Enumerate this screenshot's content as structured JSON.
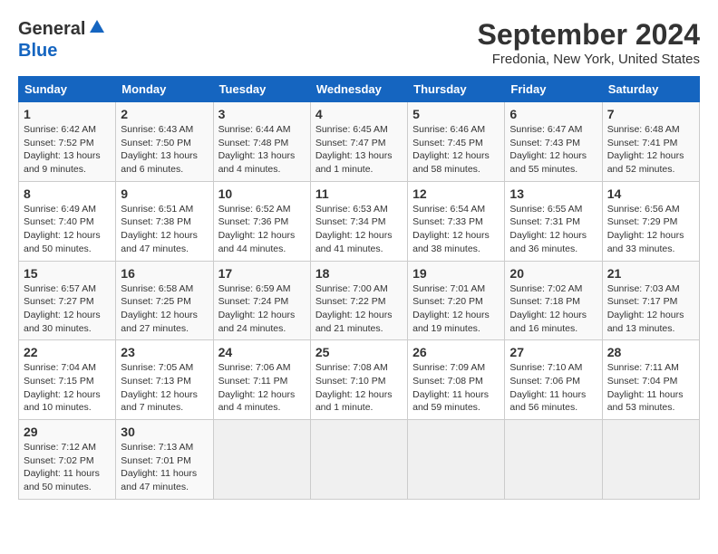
{
  "header": {
    "logo_general": "General",
    "logo_blue": "Blue",
    "month_title": "September 2024",
    "location": "Fredonia, New York, United States"
  },
  "days_of_week": [
    "Sunday",
    "Monday",
    "Tuesday",
    "Wednesday",
    "Thursday",
    "Friday",
    "Saturday"
  ],
  "weeks": [
    [
      {
        "day": "1",
        "info": "Sunrise: 6:42 AM\nSunset: 7:52 PM\nDaylight: 13 hours\nand 9 minutes."
      },
      {
        "day": "2",
        "info": "Sunrise: 6:43 AM\nSunset: 7:50 PM\nDaylight: 13 hours\nand 6 minutes."
      },
      {
        "day": "3",
        "info": "Sunrise: 6:44 AM\nSunset: 7:48 PM\nDaylight: 13 hours\nand 4 minutes."
      },
      {
        "day": "4",
        "info": "Sunrise: 6:45 AM\nSunset: 7:47 PM\nDaylight: 13 hours\nand 1 minute."
      },
      {
        "day": "5",
        "info": "Sunrise: 6:46 AM\nSunset: 7:45 PM\nDaylight: 12 hours\nand 58 minutes."
      },
      {
        "day": "6",
        "info": "Sunrise: 6:47 AM\nSunset: 7:43 PM\nDaylight: 12 hours\nand 55 minutes."
      },
      {
        "day": "7",
        "info": "Sunrise: 6:48 AM\nSunset: 7:41 PM\nDaylight: 12 hours\nand 52 minutes."
      }
    ],
    [
      {
        "day": "8",
        "info": "Sunrise: 6:49 AM\nSunset: 7:40 PM\nDaylight: 12 hours\nand 50 minutes."
      },
      {
        "day": "9",
        "info": "Sunrise: 6:51 AM\nSunset: 7:38 PM\nDaylight: 12 hours\nand 47 minutes."
      },
      {
        "day": "10",
        "info": "Sunrise: 6:52 AM\nSunset: 7:36 PM\nDaylight: 12 hours\nand 44 minutes."
      },
      {
        "day": "11",
        "info": "Sunrise: 6:53 AM\nSunset: 7:34 PM\nDaylight: 12 hours\nand 41 minutes."
      },
      {
        "day": "12",
        "info": "Sunrise: 6:54 AM\nSunset: 7:33 PM\nDaylight: 12 hours\nand 38 minutes."
      },
      {
        "day": "13",
        "info": "Sunrise: 6:55 AM\nSunset: 7:31 PM\nDaylight: 12 hours\nand 36 minutes."
      },
      {
        "day": "14",
        "info": "Sunrise: 6:56 AM\nSunset: 7:29 PM\nDaylight: 12 hours\nand 33 minutes."
      }
    ],
    [
      {
        "day": "15",
        "info": "Sunrise: 6:57 AM\nSunset: 7:27 PM\nDaylight: 12 hours\nand 30 minutes."
      },
      {
        "day": "16",
        "info": "Sunrise: 6:58 AM\nSunset: 7:25 PM\nDaylight: 12 hours\nand 27 minutes."
      },
      {
        "day": "17",
        "info": "Sunrise: 6:59 AM\nSunset: 7:24 PM\nDaylight: 12 hours\nand 24 minutes."
      },
      {
        "day": "18",
        "info": "Sunrise: 7:00 AM\nSunset: 7:22 PM\nDaylight: 12 hours\nand 21 minutes."
      },
      {
        "day": "19",
        "info": "Sunrise: 7:01 AM\nSunset: 7:20 PM\nDaylight: 12 hours\nand 19 minutes."
      },
      {
        "day": "20",
        "info": "Sunrise: 7:02 AM\nSunset: 7:18 PM\nDaylight: 12 hours\nand 16 minutes."
      },
      {
        "day": "21",
        "info": "Sunrise: 7:03 AM\nSunset: 7:17 PM\nDaylight: 12 hours\nand 13 minutes."
      }
    ],
    [
      {
        "day": "22",
        "info": "Sunrise: 7:04 AM\nSunset: 7:15 PM\nDaylight: 12 hours\nand 10 minutes."
      },
      {
        "day": "23",
        "info": "Sunrise: 7:05 AM\nSunset: 7:13 PM\nDaylight: 12 hours\nand 7 minutes."
      },
      {
        "day": "24",
        "info": "Sunrise: 7:06 AM\nSunset: 7:11 PM\nDaylight: 12 hours\nand 4 minutes."
      },
      {
        "day": "25",
        "info": "Sunrise: 7:08 AM\nSunset: 7:10 PM\nDaylight: 12 hours\nand 1 minute."
      },
      {
        "day": "26",
        "info": "Sunrise: 7:09 AM\nSunset: 7:08 PM\nDaylight: 11 hours\nand 59 minutes."
      },
      {
        "day": "27",
        "info": "Sunrise: 7:10 AM\nSunset: 7:06 PM\nDaylight: 11 hours\nand 56 minutes."
      },
      {
        "day": "28",
        "info": "Sunrise: 7:11 AM\nSunset: 7:04 PM\nDaylight: 11 hours\nand 53 minutes."
      }
    ],
    [
      {
        "day": "29",
        "info": "Sunrise: 7:12 AM\nSunset: 7:02 PM\nDaylight: 11 hours\nand 50 minutes."
      },
      {
        "day": "30",
        "info": "Sunrise: 7:13 AM\nSunset: 7:01 PM\nDaylight: 11 hours\nand 47 minutes."
      },
      {
        "day": "",
        "info": ""
      },
      {
        "day": "",
        "info": ""
      },
      {
        "day": "",
        "info": ""
      },
      {
        "day": "",
        "info": ""
      },
      {
        "day": "",
        "info": ""
      }
    ]
  ]
}
